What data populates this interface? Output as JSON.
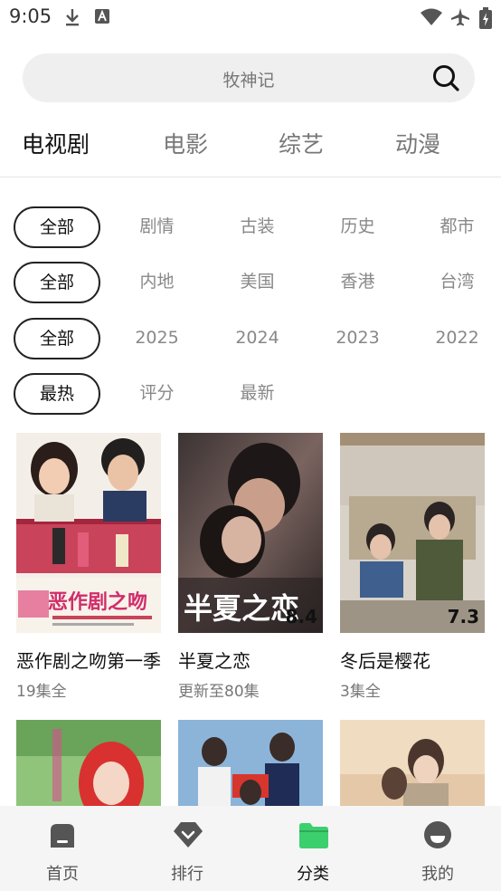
{
  "status_bar": {
    "time": "9:05"
  },
  "search": {
    "placeholder": "牧神记"
  },
  "tabs": [
    {
      "label": "电视剧",
      "active": true
    },
    {
      "label": "电影",
      "active": false
    },
    {
      "label": "综艺",
      "active": false
    },
    {
      "label": "动漫",
      "active": false
    }
  ],
  "filters": {
    "genre": [
      "全部",
      "剧情",
      "古装",
      "历史",
      "都市"
    ],
    "region": [
      "全部",
      "内地",
      "美国",
      "香港",
      "台湾"
    ],
    "year": [
      "全部",
      "2025",
      "2024",
      "2023",
      "2022"
    ],
    "sort": [
      "最热",
      "评分",
      "最新"
    ]
  },
  "videos": [
    {
      "title": "恶作剧之吻第一季",
      "subtitle": "19集全",
      "score": ""
    },
    {
      "title": "半夏之恋",
      "subtitle": "更新至80集",
      "score": "8.4"
    },
    {
      "title": "冬后是樱花",
      "subtitle": "3集全",
      "score": "7.3"
    }
  ],
  "bottom_nav": [
    {
      "label": "首页",
      "icon": "home-icon"
    },
    {
      "label": "排行",
      "icon": "ranking-icon"
    },
    {
      "label": "分类",
      "icon": "category-folder-icon",
      "active": true
    },
    {
      "label": "我的",
      "icon": "profile-icon"
    }
  ],
  "colors": {
    "accent": "#3ccf6e",
    "chip_border": "#222222",
    "muted": "#888888"
  }
}
